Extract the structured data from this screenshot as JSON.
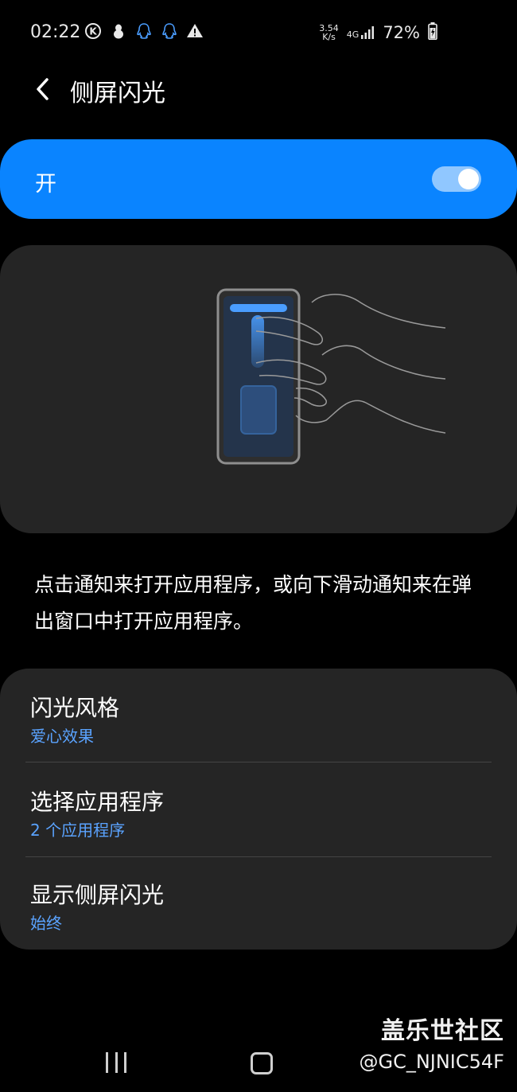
{
  "status_bar": {
    "time": "02:22",
    "net_speed_value": "3.54",
    "net_speed_unit": "K/s",
    "network": "4G",
    "battery": "72%",
    "icons": [
      "k-circle-icon",
      "penguin-icon",
      "qq-icon",
      "qq-icon",
      "warning-icon",
      "signal-icon",
      "battery-charging-icon"
    ]
  },
  "header": {
    "title": "侧屏闪光",
    "back_icon": "chevron-left-icon"
  },
  "master_switch": {
    "label": "开",
    "state": "on",
    "accent_color": "#0a84ff"
  },
  "description": "点击通知来打开应用程序，或向下滑动通知来在弹出窗口中打开应用程序。",
  "settings": [
    {
      "title": "闪光风格",
      "value": "爱心效果"
    },
    {
      "title": "选择应用程序",
      "value": "2 个应用程序"
    },
    {
      "title": "显示侧屏闪光",
      "value": "始终"
    }
  ],
  "watermark": {
    "title": "盖乐世社区",
    "user": "@GC_NJNIC54F"
  },
  "colors": {
    "background": "#000000",
    "card": "#252525",
    "accent": "#0a84ff",
    "subtitle": "#5aa3ff"
  }
}
